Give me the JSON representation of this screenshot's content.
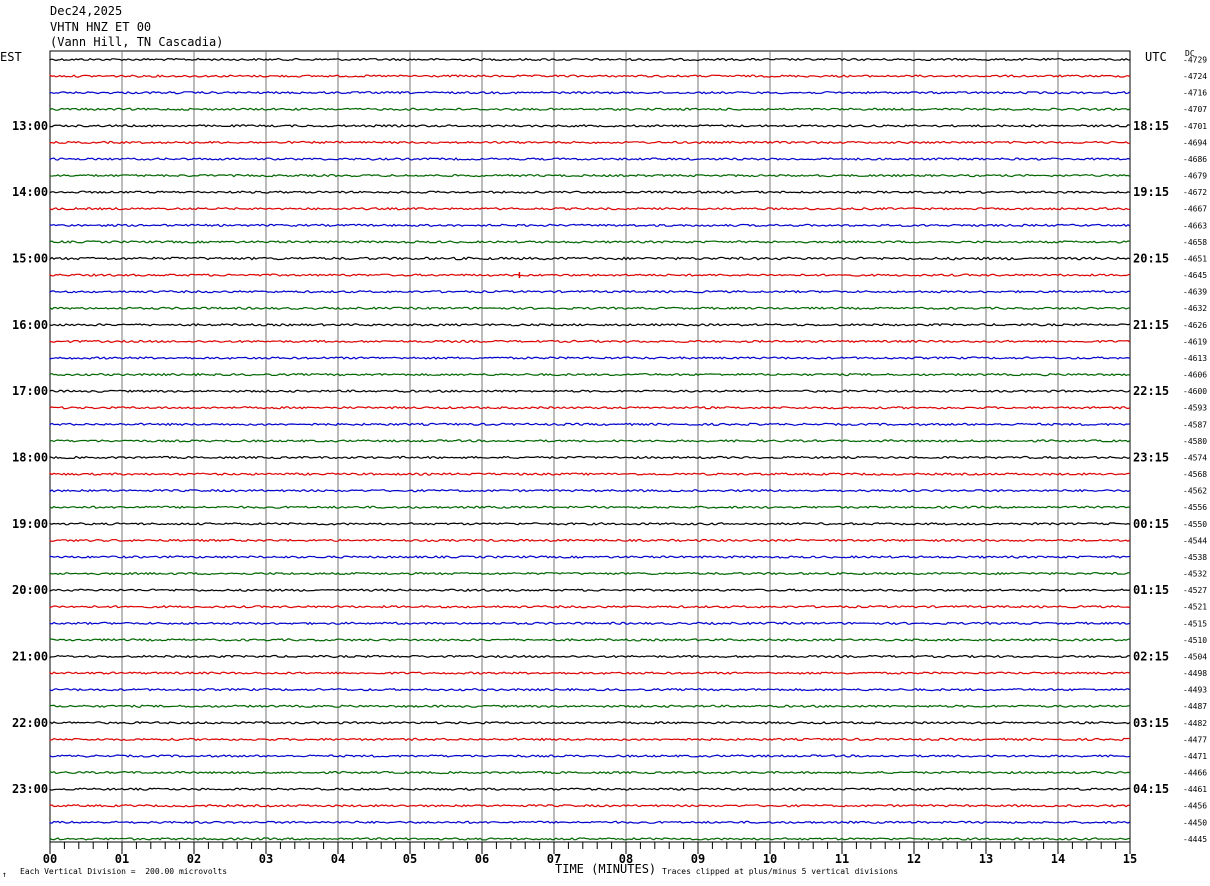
{
  "header": {
    "date": "Dec24,2025",
    "channel": "VHTN HNZ ET 00",
    "station": "(Vann Hill, TN Cascadia)"
  },
  "left_timezone": "EST",
  "right_timezone": "UTC",
  "dc_label": "DC",
  "footer": {
    "scale_note": "Each Vertical Division =  200.00 microvolts",
    "xlabel": "TIME (MINUTES)",
    "clip_note": "Traces clipped at plus/minus 5 vertical divisions",
    "corner_mark": "↑"
  },
  "chart_data": {
    "type": "line",
    "title": "VHTN HNZ ET 00",
    "xlabel": "TIME (MINUTES)",
    "xlim": [
      0,
      15
    ],
    "x_ticks": [
      "00",
      "01",
      "02",
      "03",
      "04",
      "05",
      "06",
      "07",
      "08",
      "09",
      "10",
      "11",
      "12",
      "13",
      "14",
      "15"
    ],
    "row_minutes": 15,
    "trace_colors": [
      "#000000",
      "#dd0000",
      "#0000cc",
      "#006600"
    ],
    "left_hour_labels": [
      "13:00",
      "14:00",
      "15:00",
      "16:00",
      "17:00",
      "18:00",
      "19:00",
      "20:00",
      "21:00",
      "22:00",
      "23:00"
    ],
    "right_hour_labels": [
      "18:15",
      "19:15",
      "20:15",
      "21:15",
      "22:15",
      "23:15",
      "00:15",
      "01:15",
      "02:15",
      "03:15",
      "04:15"
    ],
    "dc_offsets": [
      -4729,
      -4724,
      -4716,
      -4707,
      -4701,
      -4694,
      -4686,
      -4679,
      -4672,
      -4667,
      -4663,
      -4658,
      -4651,
      -4645,
      -4639,
      -4632,
      -4626,
      -4619,
      -4613,
      -4606,
      -4600,
      -4593,
      -4587,
      -4580,
      -4574,
      -4568,
      -4562,
      -4556,
      -4550,
      -4544,
      -4538,
      -4532,
      -4527,
      -4521,
      -4515,
      -4510,
      -4504,
      -4498,
      -4493,
      -4487,
      -4482,
      -4477,
      -4471,
      -4466,
      -4461,
      -4456,
      -4450,
      -4445
    ],
    "noise_amplitude_per_row": [
      1,
      1,
      1,
      1,
      1,
      1,
      1,
      1,
      1,
      1,
      1,
      1,
      1.2,
      1,
      1,
      1,
      1,
      1,
      1,
      1,
      1,
      1,
      1,
      1,
      1,
      1,
      1,
      1,
      1,
      1,
      1,
      1,
      1,
      1,
      1,
      1,
      1,
      1,
      1,
      1,
      1,
      1,
      1,
      1,
      1,
      1,
      1,
      1
    ],
    "events": [
      {
        "row": 13,
        "minute": 6.52,
        "amplitude": 3
      }
    ]
  }
}
